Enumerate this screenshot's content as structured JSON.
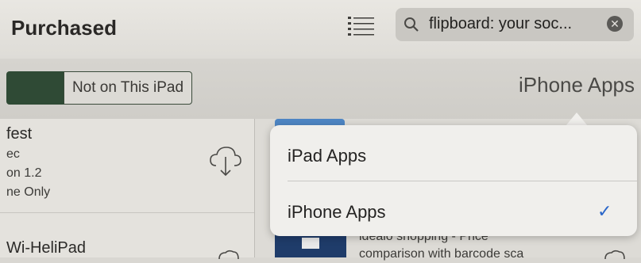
{
  "header": {
    "title": "Purchased",
    "list_icon": "list-icon"
  },
  "search": {
    "value": "flipboard: your soc...",
    "search_icon": "search-icon",
    "clear_icon": "clear-icon"
  },
  "segments": {
    "active_label": "",
    "inactive_label": "Not on This iPad",
    "category": "iPhone Apps"
  },
  "left_item": {
    "title": "fest",
    "lines": [
      "ec",
      "on 1.2",
      "ne Only"
    ],
    "cloud_icon": "cloud-download-icon",
    "next_title": "Wi-HeliPad"
  },
  "background": {
    "line1": "idealo shopping - Price",
    "line2": "comparison with barcode sca"
  },
  "popover": {
    "options": [
      {
        "label": "iPad Apps",
        "selected": false
      },
      {
        "label": "iPhone Apps",
        "selected": true
      }
    ],
    "check": "✓"
  },
  "colors": {
    "accent": "#2a66c9",
    "segment_active": "#2f4a35"
  }
}
